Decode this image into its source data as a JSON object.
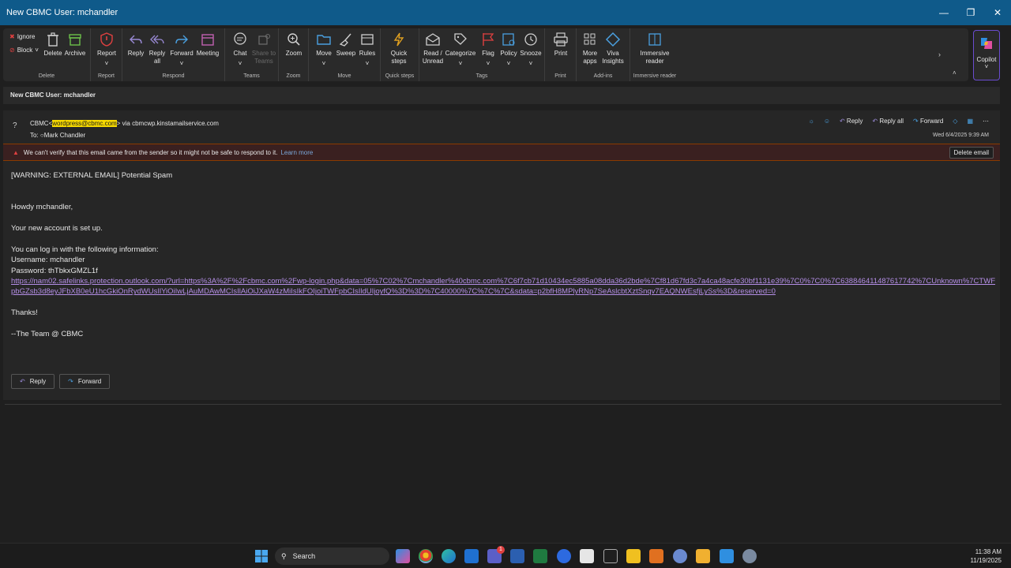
{
  "window": {
    "title": "New CBMC User: mchandler"
  },
  "ribbon": {
    "delete_group": {
      "ignore": "Ignore",
      "block": "Block",
      "delete": "Delete",
      "archive": "Archive",
      "label": "Delete"
    },
    "report_group": {
      "report": "Report",
      "label": "Report"
    },
    "respond_group": {
      "reply": "Reply",
      "reply_all": "Reply\nall",
      "forward": "Forward",
      "meeting": "Meeting",
      "label": "Respond"
    },
    "teams_group": {
      "chat": "Chat",
      "share": "Share to\nTeams",
      "label": "Teams"
    },
    "zoom_group": {
      "zoom": "Zoom",
      "label": "Zoom"
    },
    "move_group": {
      "move": "Move",
      "sweep": "Sweep",
      "rules": "Rules",
      "label": "Move"
    },
    "quicksteps_group": {
      "quick": "Quick\nsteps",
      "label": "Quick steps"
    },
    "tags_group": {
      "read": "Read /\nUnread",
      "categorize": "Categorize",
      "flag": "Flag",
      "policy": "Policy",
      "snooze": "Snooze",
      "label": "Tags"
    },
    "print_group": {
      "print": "Print",
      "label": "Print"
    },
    "addins_group": {
      "more": "More\napps",
      "viva": "Viva\nInsights",
      "label": "Add-ins"
    },
    "immersive_group": {
      "immersive": "Immersive\nreader",
      "label": "Immersive reader"
    },
    "copilot": "Copilot"
  },
  "subject_bar": "New CBMC User: mchandler",
  "message": {
    "avatar": "?",
    "from_name": "CBMC",
    "from_email": "wordpress@cbmc.com",
    "via": "via cbmcwp.kinstamailservice.com",
    "to_label": "To:",
    "to_name": "Mark Chandler",
    "actions": {
      "reply": "Reply",
      "reply_all": "Reply all",
      "forward": "Forward"
    },
    "date": "Wed 6/4/2025 9:39 AM",
    "warning": "We can't verify that this email came from the sender so it might not be safe to respond to it.",
    "warning_link": "Learn more",
    "delete_email": "Delete email",
    "body": {
      "line1": "[WARNING: EXTERNAL EMAIL] Potential Spam",
      "greeting": "Howdy mchandler,",
      "setup": "Your new account is set up.",
      "login": "You can log in with the following information:",
      "username": "Username: mchandler",
      "password": "Password: thTbkxGMZL1f",
      "link": "https://nam02.safelinks.protection.outlook.com/?url=https%3A%2F%2Fcbmc.com%2Fwp-login.php&data=05%7C02%7Cmchandler%40cbmc.com%7C6f7cb71d10434ec5885a08dda36d2bde%7Cf81d67fd3c7a4ca48acfe30bf1131e39%7C0%7C0%7C638846411487617742%7CUnknown%7CTWFpbGZsb3d8eyJFbXB0eU1hcGkiOnRydWUsIlYiOiIwLjAuMDAwMCIsIlAiOiJXaW4zMiIsIkFOIjoiTWFpbCIsIldUIjoyfQ%3D%3D%7C40000%7C%7C%7C&sdata=p2bfH8MPlyRNp7SeAslcbtXztSnqv7EAQNWEsfjLySs%3D&reserved=0",
      "thanks": "Thanks!",
      "signature": "--The Team @ CBMC"
    },
    "reply_btn": "Reply",
    "forward_btn": "Forward"
  },
  "taskbar": {
    "search": "Search",
    "time": "11:38 AM",
    "date": "11/19/2025",
    "teams_badge": "1"
  },
  "colors": {
    "titlebar": "#0f5a8a",
    "accent": "#f5d800",
    "link": "#b48ee6",
    "warning_bg": "#3a2020"
  }
}
